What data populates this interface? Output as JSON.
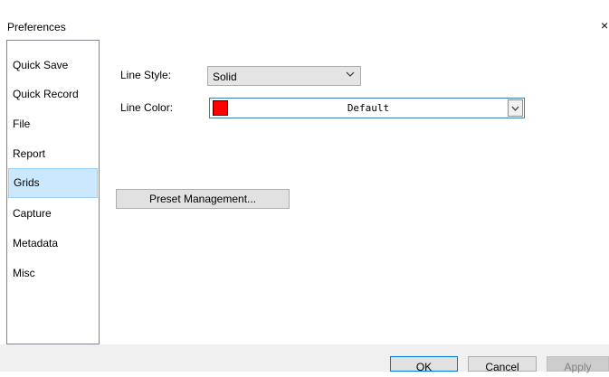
{
  "window": {
    "title": "Preferences",
    "close_glyph": "×"
  },
  "sidebar": {
    "items": [
      {
        "label": "Quick Save",
        "selected": false
      },
      {
        "label": "Quick Record",
        "selected": false
      },
      {
        "label": "File",
        "selected": false
      },
      {
        "label": "Report",
        "selected": false
      },
      {
        "label": "Grids",
        "selected": true
      },
      {
        "label": "Capture",
        "selected": false
      },
      {
        "label": "Metadata",
        "selected": false
      },
      {
        "label": "Misc",
        "selected": false
      }
    ]
  },
  "grids": {
    "line_style_label": "Line Style:",
    "line_style_value": "Solid",
    "line_color_label": "Line Color:",
    "line_color_value": "Default",
    "line_color_swatch": "#ff0000",
    "preset_button": "Preset Management..."
  },
  "footer": {
    "ok_label": "OK",
    "cancel_label": "Cancel",
    "apply_label": "Apply",
    "apply_enabled": false
  },
  "colors": {
    "selected_bg": "#cce8ff",
    "selected_border": "#99d1ff",
    "focus_border": "#0078d7"
  }
}
